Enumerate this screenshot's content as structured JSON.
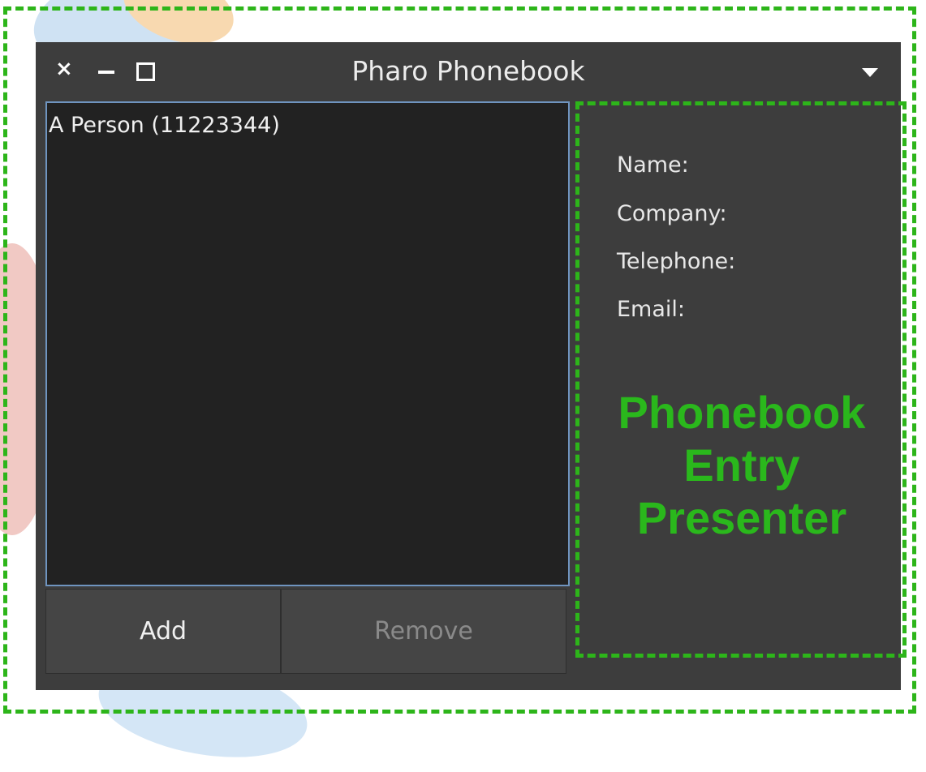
{
  "window": {
    "title": "Pharo Phonebook",
    "close_glyph": "×",
    "minimize_icon": "minimize-icon",
    "maximize_icon": "maximize-icon",
    "menu_icon": "dropdown-arrow-icon"
  },
  "list": {
    "items": [
      "A Person (11223344)"
    ],
    "border_color": "#6f94bf"
  },
  "buttons": {
    "add_label": "Add",
    "remove_label": "Remove"
  },
  "entry": {
    "name_label": "Name:",
    "company_label": "Company:",
    "telephone_label": "Telephone:",
    "email_label": "Email:"
  },
  "annotation": {
    "line1": "Phonebook",
    "line2": "Entry",
    "line3": "Presenter",
    "color": "#2ab81c"
  }
}
